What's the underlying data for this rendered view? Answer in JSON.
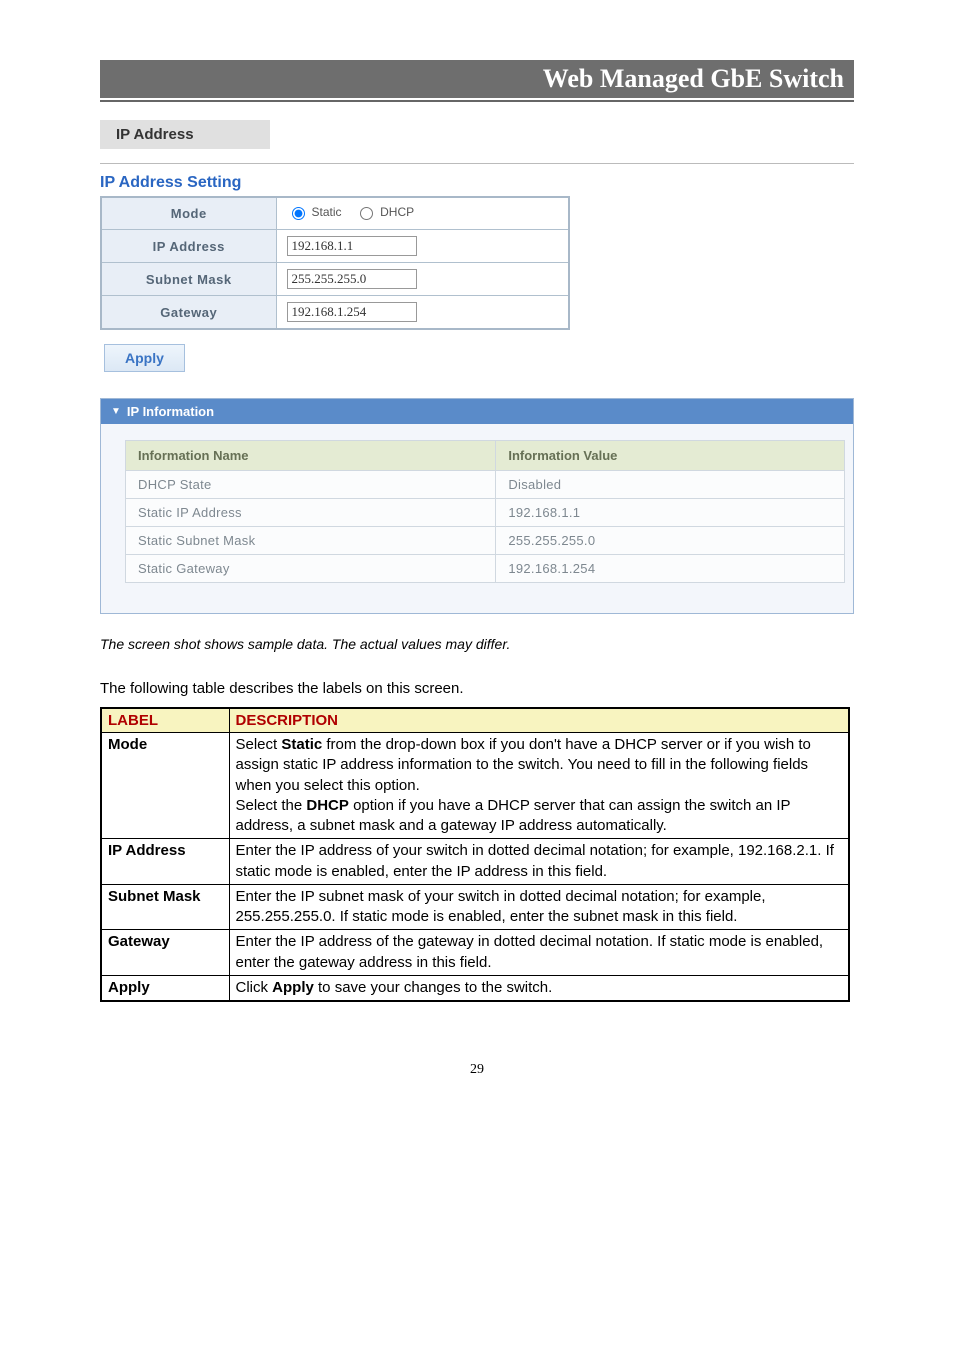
{
  "header": {
    "title": "Web Managed GbE Switch"
  },
  "section_tab": "IP Address",
  "setting_title": "IP Address Setting",
  "form": {
    "rows": {
      "mode_label": "Mode",
      "ip_label": "IP Address",
      "mask_label": "Subnet Mask",
      "gateway_label": "Gateway"
    },
    "radio": {
      "static": "Static",
      "dhcp": "DHCP"
    },
    "values": {
      "ip": "192.168.1.1",
      "mask": "255.255.255.0",
      "gateway": "192.168.1.254"
    }
  },
  "apply_label": "Apply",
  "info_panel": {
    "title": "IP Information",
    "headers": {
      "name": "Information Name",
      "value": "Information Value"
    },
    "rows": [
      {
        "name": "DHCP State",
        "value": "Disabled"
      },
      {
        "name": "Static IP Address",
        "value": "192.168.1.1"
      },
      {
        "name": "Static Subnet Mask",
        "value": "255.255.255.0"
      },
      {
        "name": "Static Gateway",
        "value": "192.168.1.254"
      }
    ]
  },
  "caption": "The screen shot shows sample data. The actual values may differ.",
  "body_text": "The following table describes the labels on this screen.",
  "desc_table": {
    "headers": {
      "label": "LABEL",
      "desc": "DESCRIPTION"
    },
    "rows": [
      {
        "label": "Mode",
        "desc_pre": "Select ",
        "b1": "Static",
        "desc_mid1": " from the drop-down box if you don't have a DHCP server or if you wish to assign static IP address information to the switch. You need to fill in the following fields when you select this option.\nSelect the ",
        "b2": "DHCP",
        "desc_post": " option if you have a DHCP server that can assign the switch an IP address, a subnet mask and a gateway IP address automatically."
      },
      {
        "label": "IP Address",
        "desc": "Enter the IP address of your switch in dotted decimal notation; for example, 192.168.2.1. If static mode is enabled, enter the IP address in this field."
      },
      {
        "label": "Subnet Mask",
        "desc": "Enter the IP subnet mask of your switch in dotted decimal notation; for example, 255.255.255.0. If static mode is enabled, enter the subnet mask in this field."
      },
      {
        "label": "Gateway",
        "desc": "Enter the IP address of the gateway in dotted decimal notation. If static mode is enabled, enter the gateway address in this field."
      },
      {
        "label": "Apply",
        "desc_pre": "Click ",
        "b1": "Apply",
        "desc_post": " to save your changes to the switch."
      }
    ]
  },
  "page_num": "29"
}
